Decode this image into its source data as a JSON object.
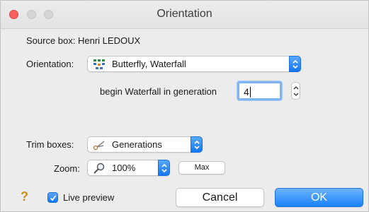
{
  "window": {
    "title": "Orientation"
  },
  "source": {
    "label": "Source box: Henri LEDOUX"
  },
  "orientation": {
    "label": "Orientation:",
    "value": "Butterfly, Waterfall"
  },
  "waterfall": {
    "label": "begin Waterfall in generation",
    "value": "4"
  },
  "trim": {
    "label": "Trim boxes:",
    "value": "Generations"
  },
  "zoom": {
    "label": "Zoom:",
    "value": "100%",
    "max_label": "Max"
  },
  "footer": {
    "help_symbol": "?",
    "live_preview_label": "Live preview",
    "live_preview_checked": true,
    "cancel_label": "Cancel",
    "ok_label": "OK"
  },
  "colors": {
    "accent": "#1a82fb",
    "close": "#fc605c"
  }
}
